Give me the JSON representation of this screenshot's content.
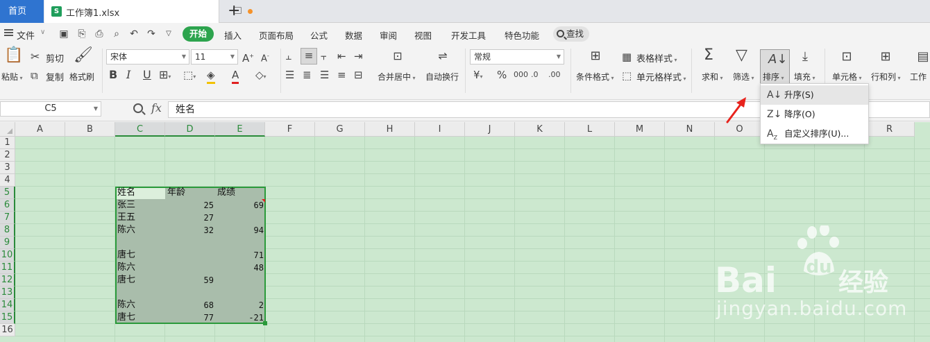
{
  "tabs": {
    "home": "首页",
    "file": "工作簿1.xlsx",
    "add": "+"
  },
  "menu": {
    "file": "文件",
    "items": [
      "开始",
      "插入",
      "页面布局",
      "公式",
      "数据",
      "审阅",
      "视图",
      "开发工具",
      "特色功能"
    ],
    "search": "查找"
  },
  "ribbon": {
    "paste": "粘贴",
    "cut": "剪切",
    "copy": "复制",
    "format_painter": "格式刷",
    "font_name": "宋体",
    "font_size": "11",
    "number_format": "常规",
    "merge_center": "合并居中",
    "wrap_text": "自动换行",
    "cond_format": "条件格式",
    "table_style": "表格样式",
    "cell_style": "单元格样式",
    "sum": "求和",
    "filter": "筛选",
    "sort": "排序",
    "fill": "填充",
    "cells": "单元格",
    "row_col": "行和列",
    "worksheet": "工作"
  },
  "formula_bar": {
    "cell_ref": "C5",
    "fx": "fx",
    "value": "姓名"
  },
  "columns": [
    "A",
    "B",
    "C",
    "D",
    "E",
    "F",
    "G",
    "H",
    "I",
    "J",
    "K",
    "L",
    "M",
    "N",
    "O",
    "P",
    "Q",
    "R"
  ],
  "rows": [
    "1",
    "2",
    "3",
    "4",
    "5",
    "6",
    "7",
    "8",
    "9",
    "10",
    "11",
    "12",
    "13",
    "14",
    "15",
    "16"
  ],
  "table": {
    "header": [
      "姓名",
      "年龄",
      "成绩"
    ],
    "data": [
      [
        "张三",
        "25",
        "69"
      ],
      [
        "王五",
        "27",
        ""
      ],
      [
        "陈六",
        "32",
        "94"
      ],
      [
        "",
        "",
        ""
      ],
      [
        "唐七",
        "",
        "71"
      ],
      [
        "陈六",
        "",
        "48"
      ],
      [
        "唐七",
        "59",
        ""
      ],
      [
        "",
        "",
        ""
      ],
      [
        "陈六",
        "68",
        "2"
      ],
      [
        "唐七",
        "77",
        "-21"
      ]
    ]
  },
  "sort_menu": [
    {
      "label": "升序(S)",
      "icon": "sort-ascending-icon"
    },
    {
      "label": "降序(O)",
      "icon": "sort-descending-icon"
    },
    {
      "label": "自定义排序(U)...",
      "icon": "custom-sort-icon"
    }
  ],
  "watermark": {
    "brand": "Bai",
    "suffix": "经验",
    "url": "jingyan.baidu.com"
  },
  "colors": {
    "accent_green": "#2da44e",
    "home_tab": "#2f74d0",
    "grid_bg": "#cce8cf",
    "selection_border": "#2a9a3a",
    "arrow": "#e8231d"
  }
}
